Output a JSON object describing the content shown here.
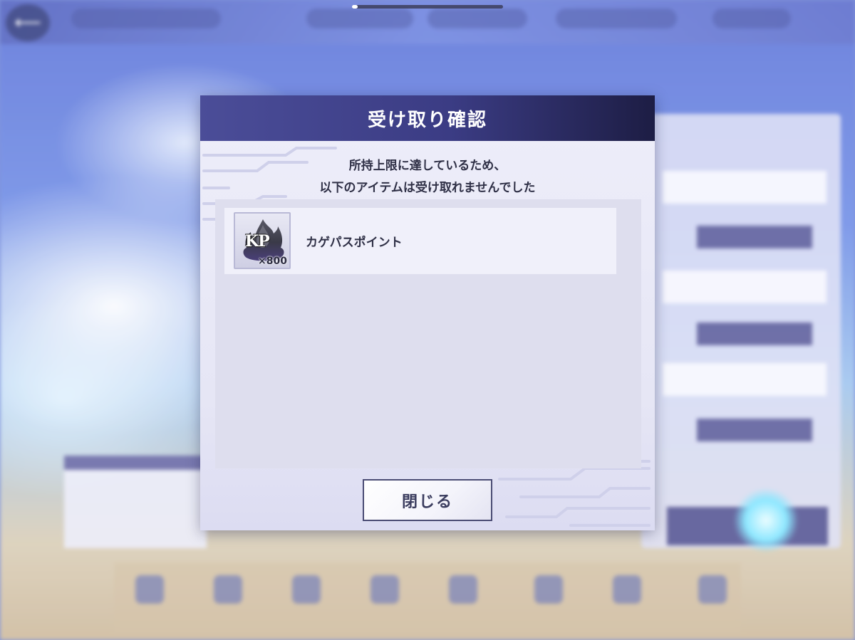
{
  "dialog": {
    "title": "受け取り確認",
    "message_line1": "所持上限に達しているため、",
    "message_line2": "以下のアイテムは受け取れませんでした",
    "items": [
      {
        "name": "カゲパスポイント",
        "icon_text": "KP",
        "icon": "kagepas-point-flame-icon",
        "quantity": "×800"
      }
    ],
    "close_label": "閉じる"
  },
  "colors": {
    "header_start": "#4b4d98",
    "header_end": "#1d1d44",
    "text": "#2f3046"
  }
}
